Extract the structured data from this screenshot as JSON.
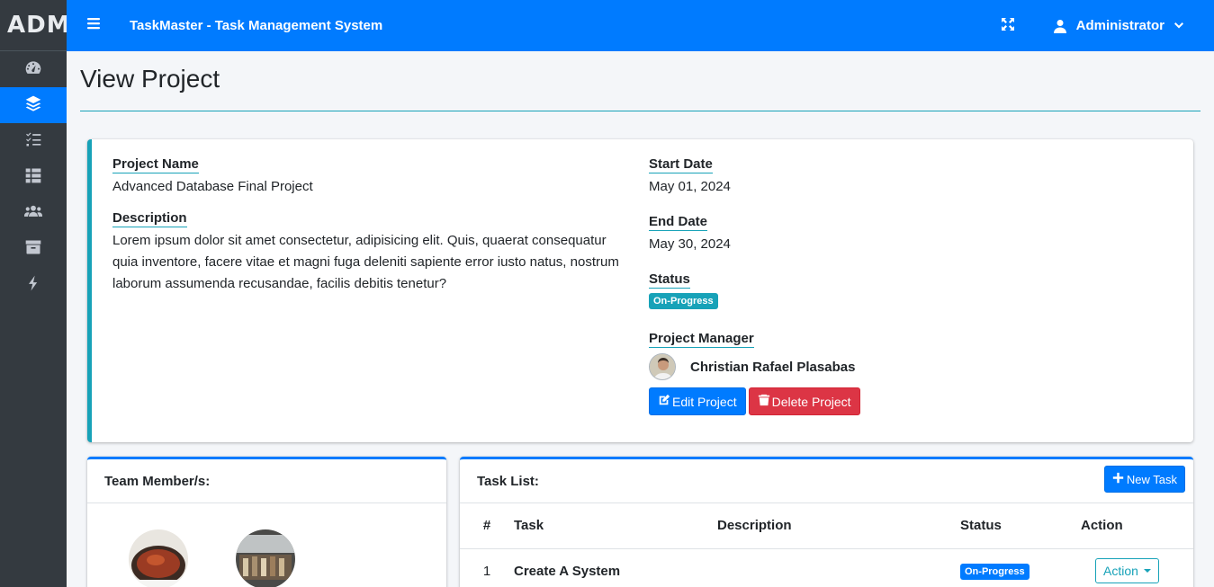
{
  "sidebar": {
    "brand": "ADMIN",
    "items": [
      {
        "icon": "tachometer-icon",
        "active": false
      },
      {
        "icon": "layers-icon",
        "active": true
      },
      {
        "icon": "tasks-icon",
        "active": false
      },
      {
        "icon": "table-icon",
        "active": false
      },
      {
        "icon": "users-icon",
        "active": false
      },
      {
        "icon": "archive-icon",
        "active": false
      },
      {
        "icon": "bolt-icon",
        "active": false
      }
    ]
  },
  "topbar": {
    "title": "TaskMaster - Task Management System",
    "user": "Administrator"
  },
  "page": {
    "title": "View Project"
  },
  "project": {
    "name_label": "Project Name",
    "name": "Advanced Database Final Project",
    "description_label": "Description",
    "description": "Lorem ipsum dolor sit amet consectetur, adipisicing elit. Quis, quaerat consequatur quia inventore, facere vitae et magni fuga deleniti sapiente error iusto natus, nostrum laborum assumenda recusandae, facilis debitis tenetur?",
    "start_label": "Start Date",
    "start": "May 01, 2024",
    "end_label": "End Date",
    "end": "May 30, 2024",
    "status_label": "Status",
    "status": "On-Progress",
    "manager_label": "Project Manager",
    "manager": "Christian Rafael Plasabas",
    "edit_label": "Edit Project",
    "delete_label": "Delete Project"
  },
  "team": {
    "title": "Team Member/s:"
  },
  "tasks": {
    "title": "Task List:",
    "new_label": "New Task",
    "columns": [
      "#",
      "Task",
      "Description",
      "Status",
      "Action"
    ],
    "rows": [
      {
        "num": "1",
        "task": "Create A System",
        "description": "",
        "status": "On-Progress",
        "action": "Action"
      }
    ]
  },
  "colors": {
    "primary": "#007bff",
    "info": "#17a2b8",
    "danger": "#dc3545",
    "sidebar": "#343a40"
  }
}
